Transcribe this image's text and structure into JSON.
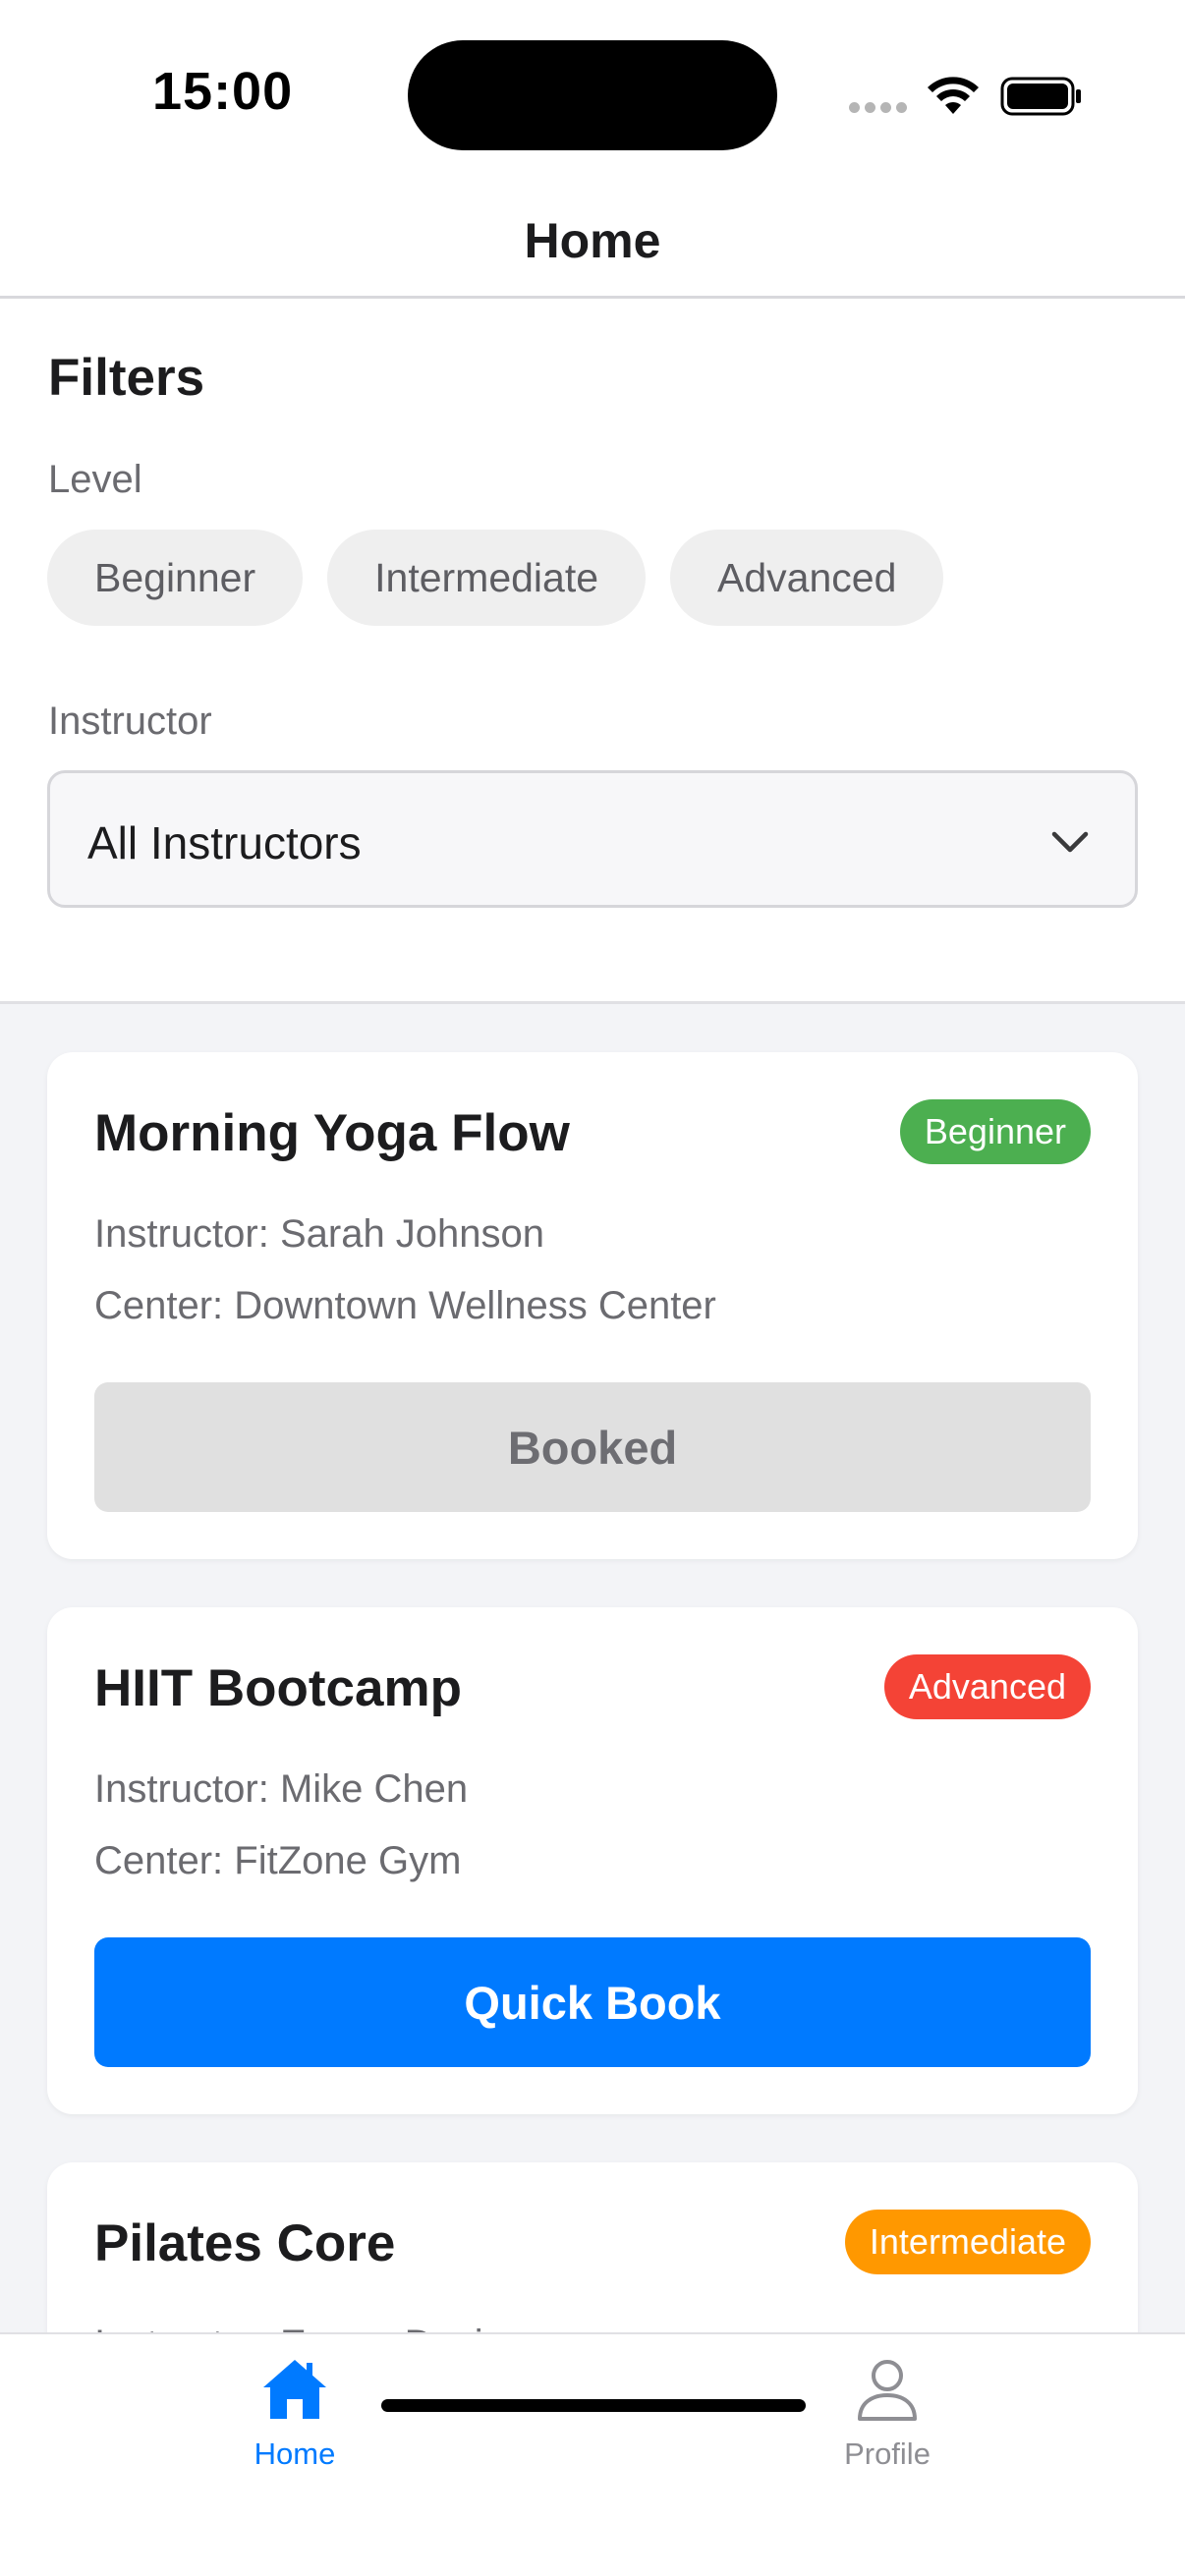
{
  "status_bar": {
    "time": "15:00"
  },
  "header": {
    "title": "Home"
  },
  "filters": {
    "title": "Filters",
    "level_label": "Level",
    "levels": [
      "Beginner",
      "Intermediate",
      "Advanced"
    ],
    "instructor_label": "Instructor",
    "instructor_value": "All Instructors"
  },
  "classes": [
    {
      "title": "Morning Yoga Flow",
      "level": "Beginner",
      "instructor": "Instructor: Sarah Johnson",
      "center": "Center: Downtown Wellness Center",
      "action": "Booked"
    },
    {
      "title": "HIIT Bootcamp",
      "level": "Advanced",
      "instructor": "Instructor: Mike Chen",
      "center": "Center: FitZone Gym",
      "action": "Quick Book"
    },
    {
      "title": "Pilates Core",
      "level": "Intermediate",
      "instructor": "Instructor: Emma Davis",
      "center": "",
      "action": ""
    }
  ],
  "tab_bar": {
    "home": {
      "label": "Home",
      "icon": "home-icon"
    },
    "profile": {
      "label": "Profile",
      "icon": "person-icon"
    }
  },
  "colors": {
    "accent": "#007aff",
    "beginner": "#4caf50",
    "advanced": "#f44336",
    "intermediate": "#ff9800"
  }
}
